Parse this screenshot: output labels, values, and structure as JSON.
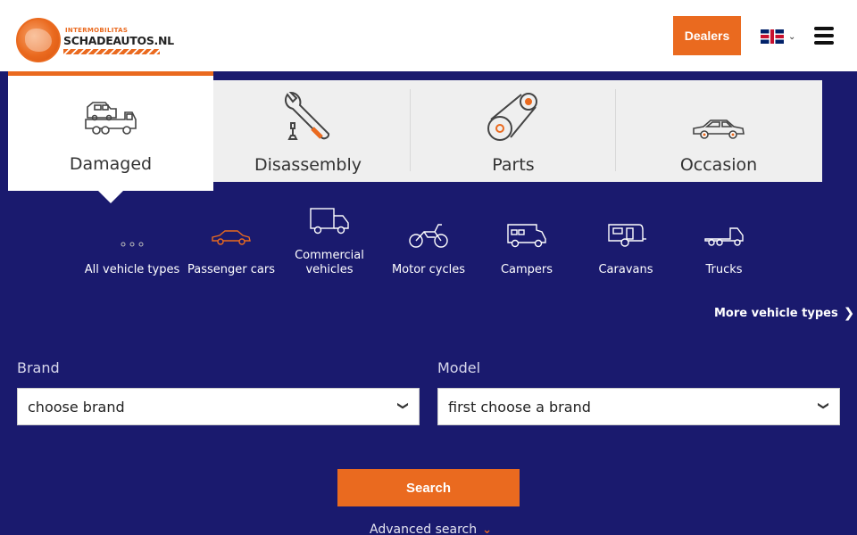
{
  "header": {
    "logo_small": "INTERMOBILITAS",
    "logo_big": "SCHADEAUTOS.NL",
    "dealers_label": "Dealers",
    "language_icon": "uk-flag-icon",
    "menu_icon": "hamburger-icon"
  },
  "categories": [
    {
      "label": "Damaged",
      "icon": "tow-truck-icon",
      "active": true
    },
    {
      "label": "Disassembly",
      "icon": "wrench-icon",
      "active": false
    },
    {
      "label": "Parts",
      "icon": "timing-belt-icon",
      "active": false
    },
    {
      "label": "Occasion",
      "icon": "car-icon",
      "active": false
    }
  ],
  "vehicle_types": [
    {
      "label": "All vehicle types",
      "icon": "dots-icon"
    },
    {
      "label": "Passenger cars",
      "icon": "passenger-car-icon"
    },
    {
      "label": "Commercial vehicles",
      "icon": "van-icon"
    },
    {
      "label": "Motor cycles",
      "icon": "motorcycle-icon"
    },
    {
      "label": "Campers",
      "icon": "camper-icon"
    },
    {
      "label": "Caravans",
      "icon": "caravan-icon"
    },
    {
      "label": "Trucks",
      "icon": "truck-icon"
    }
  ],
  "more_types_label": "More vehicle types",
  "form": {
    "brand_label": "Brand",
    "brand_value": "choose brand",
    "model_label": "Model",
    "model_value": "first choose a brand",
    "search_label": "Search",
    "advanced_label": "Advanced search"
  },
  "colors": {
    "accent": "#ea6a1f",
    "background": "#1a1a6e",
    "tab_background": "#efefef"
  }
}
